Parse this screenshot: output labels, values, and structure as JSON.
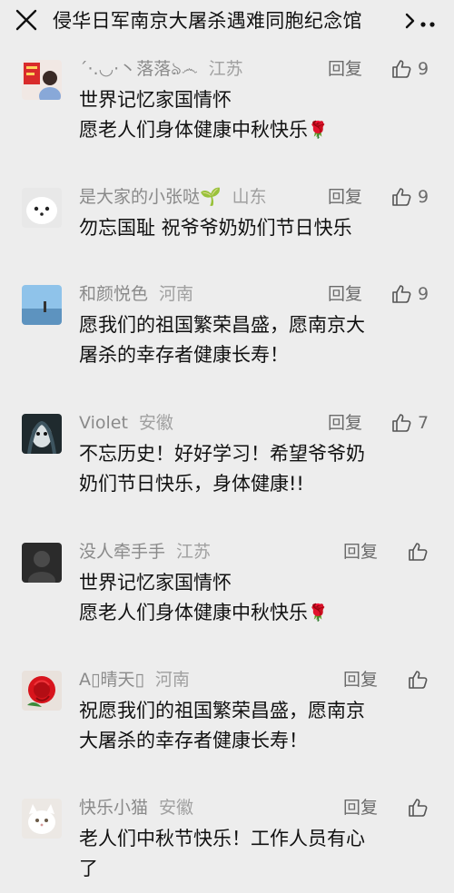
{
  "header": {
    "title": "侵华日军南京大屠杀遇难同胞纪念馆",
    "close_icon": "close-icon",
    "more_icon": "more-icon"
  },
  "comments": [
    {
      "nickname": "´·.◡·丶落落ঌ෴",
      "region": "江苏",
      "reply_label": "回复",
      "likes": "9",
      "lines": [
        "世界记忆家国情怀",
        "愿老人们身体健康中秋快乐"
      ],
      "emoji": "🌹"
    },
    {
      "nickname": "是大家的小张哒🌱",
      "region": "山东",
      "reply_label": "回复",
      "likes": "9",
      "lines": [
        "勿忘国耻 祝爷爷奶奶们节日快乐"
      ],
      "emoji": ""
    },
    {
      "nickname": "和颜悦色",
      "region": "河南",
      "reply_label": "回复",
      "likes": "9",
      "lines": [
        "愿我们的祖国繁荣昌盛，愿南京大",
        "屠杀的幸存者健康长寿！"
      ],
      "emoji": ""
    },
    {
      "nickname": "Violet",
      "region": "安徽",
      "reply_label": "回复",
      "likes": "7",
      "lines": [
        "不忘历史！好好学习！希望爷爷奶",
        "奶们节日快乐，身体健康!!"
      ],
      "emoji": ""
    },
    {
      "nickname": "没人牵手手",
      "region": "江苏",
      "reply_label": "回复",
      "likes": "",
      "lines": [
        "世界记忆家国情怀",
        "愿老人们身体健康中秋快乐"
      ],
      "emoji": "🌹"
    },
    {
      "nickname": "A▯晴天▯",
      "region": "河南",
      "reply_label": "回复",
      "likes": "",
      "lines": [
        "祝愿我们的祖国繁荣昌盛，愿南京",
        "大屠杀的幸存者健康长寿！"
      ],
      "emoji": ""
    },
    {
      "nickname": "快乐小猫",
      "region": "安徽",
      "reply_label": "回复",
      "likes": "",
      "lines": [
        "老人们中秋节快乐！工作人员有心",
        "了"
      ],
      "emoji": ""
    }
  ]
}
